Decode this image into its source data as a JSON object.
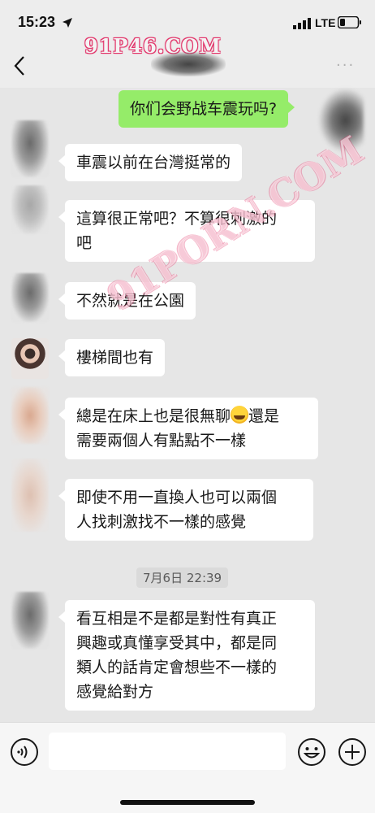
{
  "status_bar": {
    "time": "15:23",
    "network": "LTE"
  },
  "nav": {
    "watermark": "91P46.COM",
    "more_label": "···"
  },
  "chat": {
    "watermark_diagonal": "91PORN.COM",
    "messages": [
      {
        "sender": "me",
        "text": "你们会野战车震玩吗?"
      },
      {
        "sender": "other",
        "text": "車震以前在台灣挺常的"
      },
      {
        "sender": "other",
        "lines": [
          "這算很正常吧？不算很刺激的",
          "吧"
        ]
      },
      {
        "sender": "other",
        "text": "不然就是在公園"
      },
      {
        "sender": "other",
        "text": "樓梯間也有"
      },
      {
        "sender": "other",
        "lines": [
          "總是在床上也是很無聊",
          "還是",
          "需要兩個人有點點不一樣"
        ],
        "emoji": "crying-laughing-emoji"
      },
      {
        "sender": "other",
        "lines": [
          "即使不用一直換人也可以兩個",
          "人找刺激找不一樣的感覺"
        ]
      },
      {
        "sender": "other",
        "lines": [
          "看互相是不是都是對性有真正",
          "興趣或真懂享受其中，都是同",
          "類人的話肯定會想些不一樣的",
          "感覺給對方"
        ]
      }
    ],
    "timestamp": "7月6日 22:39"
  },
  "input_bar": {
    "placeholder": ""
  },
  "colors": {
    "my_bubble": "#95ec69",
    "their_bubble": "#ffffff",
    "watermark": "#e2366b"
  }
}
